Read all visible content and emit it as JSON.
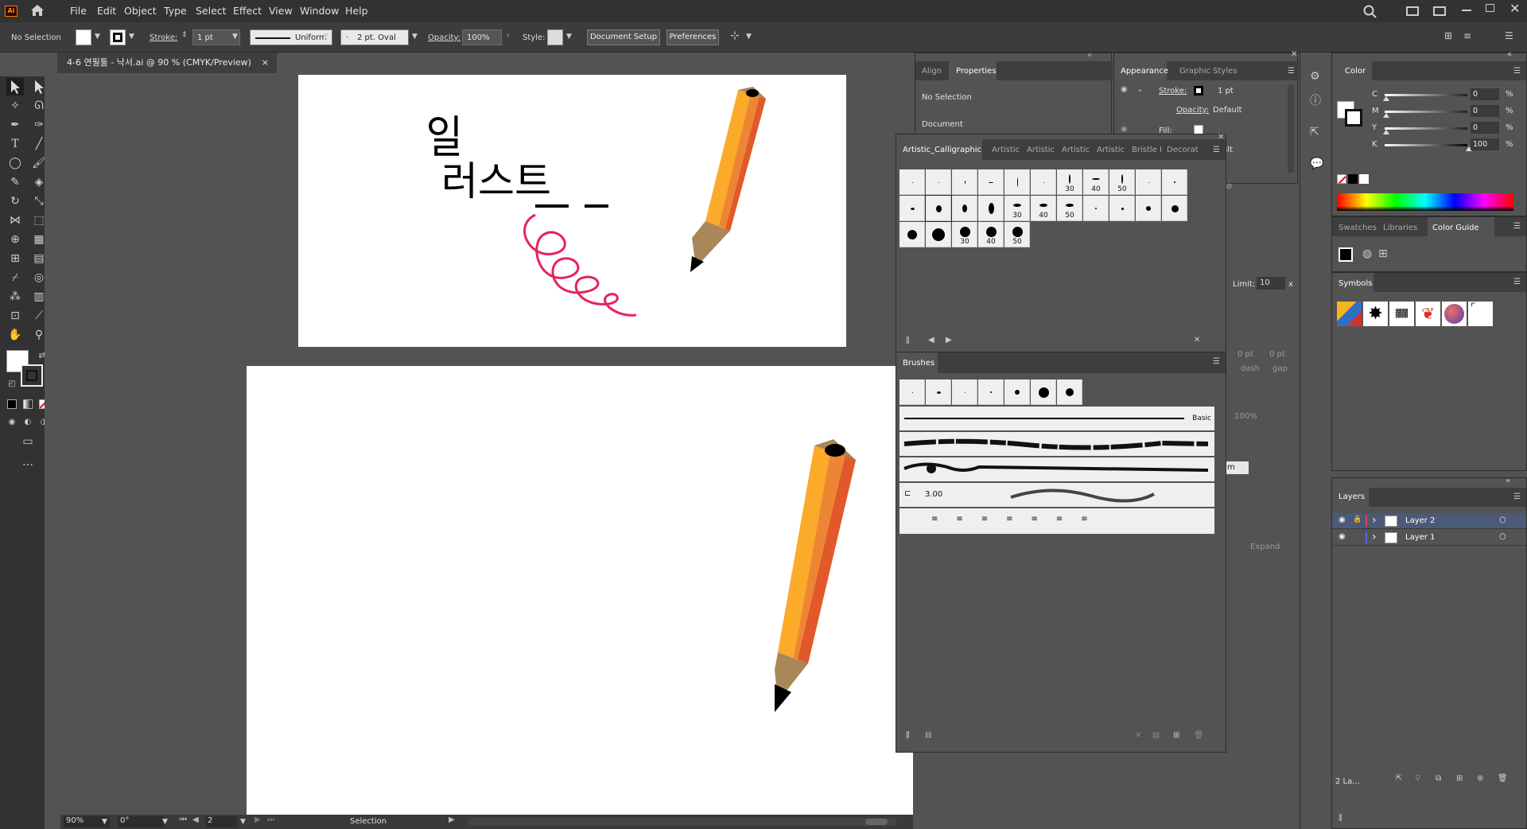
{
  "app": {
    "logo": "Ai"
  },
  "menu": [
    "File",
    "Edit",
    "Object",
    "Type",
    "Select",
    "Effect",
    "View",
    "Window",
    "Help"
  ],
  "control_bar": {
    "selection": "No Selection",
    "stroke_label": "Stroke:",
    "stroke_value": "1 pt",
    "profile": "Uniform",
    "brush": "2 pt. Oval",
    "opacity_label": "Opacity:",
    "opacity_value": "100%",
    "style_label": "Style:",
    "doc_setup": "Document Setup",
    "preferences": "Preferences"
  },
  "document_tab": {
    "title": "4-6 연필툴 - 낙서.ai @ 90 % (CMYK/Preview)",
    "close": "×"
  },
  "artboard_text": {
    "line1": "일",
    "line2": "러스트"
  },
  "status": {
    "zoom": "90%",
    "rotation": "0°",
    "artboard": "2",
    "tool": "Selection"
  },
  "properties_panel": {
    "tabs": [
      "Align",
      "Properties"
    ],
    "no_selection": "No Selection",
    "document": "Document"
  },
  "appearance_panel": {
    "tabs": [
      "Appearance",
      "Graphic Styles"
    ],
    "stroke_label": "Stroke:",
    "stroke_value": "1 pt",
    "opacity_label": "Opacity:",
    "opacity_value": "Default",
    "fill_label": "Fill:",
    "partial": "ult"
  },
  "stroke_fragments": {
    "limit_label": "Limit:",
    "limit_value": "10",
    "limit_unit": "x",
    "dash1": "0 pt",
    "dash2": "0 pt",
    "dash_label": "dash",
    "gap_label": "gap",
    "pct": "100%",
    "expand": "Expand",
    "m_box": "m"
  },
  "calligraphic_panel": {
    "tabs": [
      "Artistic_Calligraphic",
      "Artistic",
      "Artistic",
      "Artistic",
      "Artistic",
      "Bristle I",
      "Decorat"
    ],
    "row1_labels": [
      "",
      "",
      "",
      "",
      "",
      "",
      "30",
      "40",
      "50",
      "",
      ""
    ],
    "row2_labels": [
      "",
      "",
      "",
      "",
      "30",
      "40",
      "50",
      "",
      "",
      "",
      ""
    ],
    "row3_labels": [
      "",
      "",
      "30",
      "40",
      "50"
    ]
  },
  "brushes_panel": {
    "title": "Brushes",
    "basic_label": "Basic",
    "pattern_value": "3.00"
  },
  "color_panel": {
    "title": "Color",
    "channels": [
      {
        "name": "C",
        "value": "0",
        "unit": "%",
        "level": 0
      },
      {
        "name": "M",
        "value": "0",
        "unit": "%",
        "level": 0
      },
      {
        "name": "Y",
        "value": "0",
        "unit": "%",
        "level": 0
      },
      {
        "name": "K",
        "value": "100",
        "unit": "%",
        "level": 100
      }
    ]
  },
  "swatches_panel": {
    "tabs": [
      "Swatches",
      "Libraries",
      "Color Guide"
    ]
  },
  "symbols_panel": {
    "title": "Symbols"
  },
  "layers_panel": {
    "title": "Layers",
    "layers": [
      {
        "name": "Layer 2",
        "color": "#e04646",
        "selected": true
      },
      {
        "name": "Layer 1",
        "color": "#4f6de8",
        "selected": false
      }
    ],
    "count": "2 La..."
  },
  "colors": {
    "pencil_light": "#fbaa2a",
    "pencil_mid": "#ed8634",
    "pencil_dark": "#e2582a",
    "wood": "#a98758",
    "scribble": "#e5245a",
    "accent": "#46a0f5"
  }
}
